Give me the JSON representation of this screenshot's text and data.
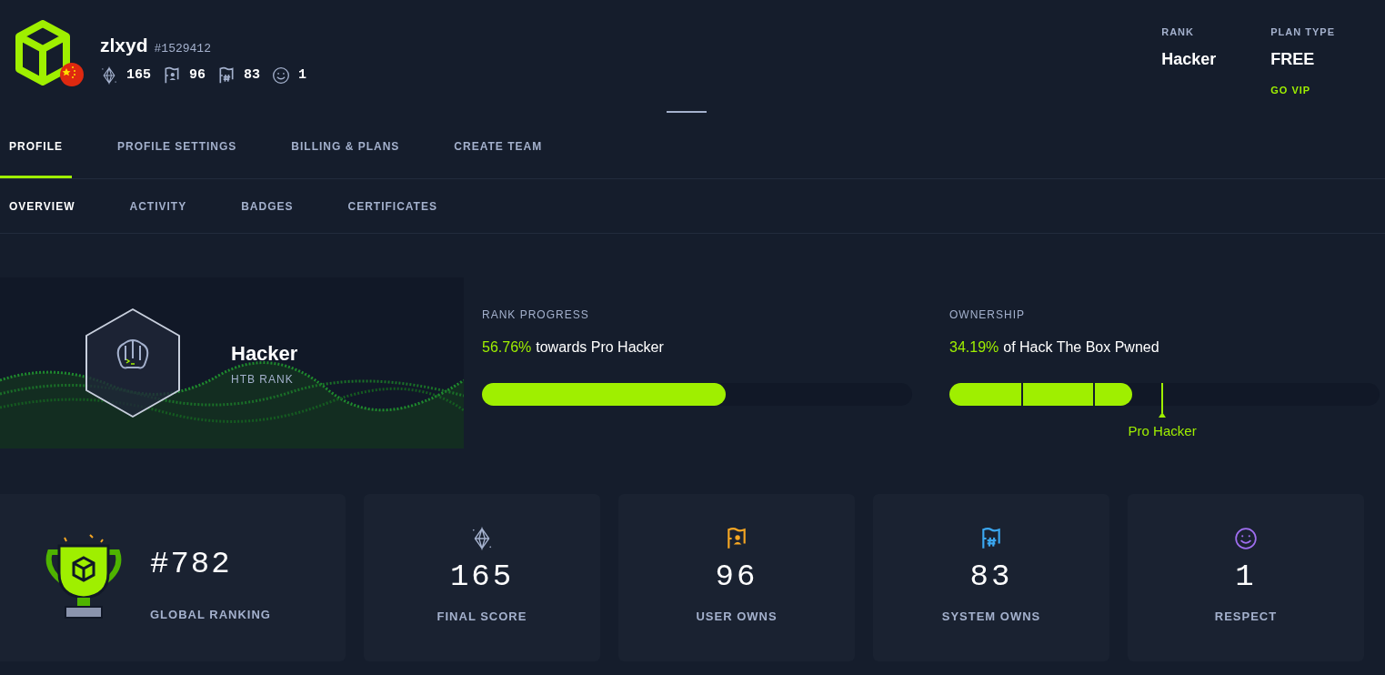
{
  "profile": {
    "username": "zlxyd",
    "user_id": "#1529412",
    "stats": [
      {
        "kind": "score",
        "value": "165"
      },
      {
        "kind": "user",
        "value": "96"
      },
      {
        "kind": "system",
        "value": "83"
      },
      {
        "kind": "respect",
        "value": "1"
      }
    ],
    "rank": {
      "label": "RANK",
      "value": "Hacker"
    },
    "plan": {
      "label": "PLAN TYPE",
      "value": "FREE",
      "link": "GO VIP"
    }
  },
  "tabs": [
    {
      "label": "PROFILE",
      "selected": true
    },
    {
      "label": "PROFILE SETTINGS",
      "selected": false
    },
    {
      "label": "BILLING & PLANS",
      "selected": false
    },
    {
      "label": "CREATE TEAM",
      "selected": false
    }
  ],
  "subtabs": [
    {
      "label": "OVERVIEW",
      "selected": true
    },
    {
      "label": "ACTIVITY",
      "selected": false
    },
    {
      "label": "BADGES",
      "selected": false
    },
    {
      "label": "CERTIFICATES",
      "selected": false
    }
  ],
  "rank_banner": {
    "title": "Hacker",
    "subtitle": "HTB RANK"
  },
  "rank_progress": {
    "label": "RANK PROGRESS",
    "percent": "56.76%",
    "text": "towards Pro Hacker",
    "level": 0.567
  },
  "ownership": {
    "label": "OWNERSHIP",
    "percent": "34.19%",
    "text": "of Hack The Box Pwned",
    "level": 0.425,
    "marker": "Pro Hacker"
  },
  "cards": [
    {
      "kind": "ranking",
      "value": "#782",
      "label": "GLOBAL RANKING"
    },
    {
      "kind": "score",
      "value": "165",
      "label": "FINAL SCORE"
    },
    {
      "kind": "user",
      "value": "96",
      "label": "USER OWNS"
    },
    {
      "kind": "system",
      "value": "83",
      "label": "SYSTEM OWNS"
    },
    {
      "kind": "respect",
      "value": "1",
      "label": "RESPECT"
    }
  ]
}
